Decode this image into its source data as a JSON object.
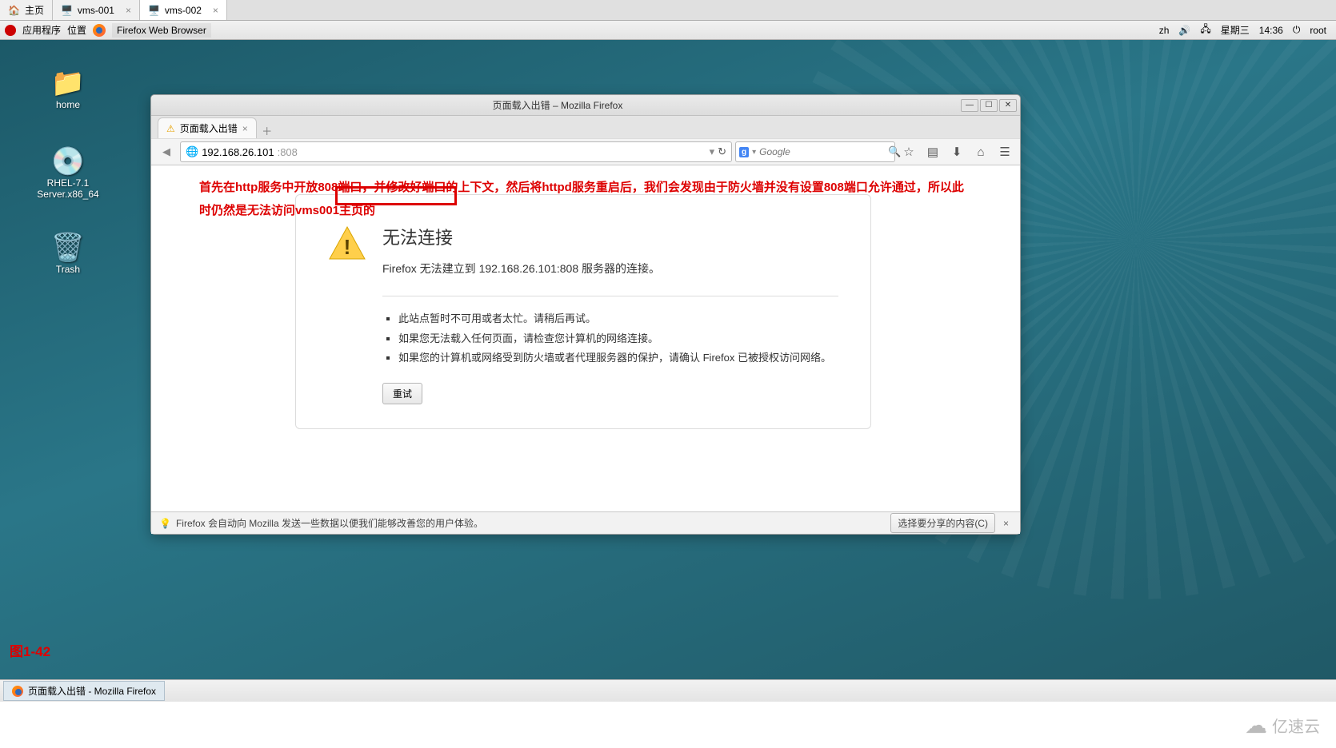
{
  "host_tabs": [
    {
      "label": "主页",
      "icon": "home"
    },
    {
      "label": "vms-001",
      "icon": "vm"
    },
    {
      "label": "vms-002",
      "icon": "vm",
      "active": true
    }
  ],
  "gnome_panel": {
    "apps_label": "应用程序",
    "places_label": "位置",
    "active_app": "Firefox Web Browser",
    "lang": "zh",
    "date": "星期三",
    "time": "14:36",
    "user": "root"
  },
  "desktop_icons": {
    "home": "home",
    "media": "RHEL-7.1 Server.x86_64",
    "trash": "Trash"
  },
  "figure_label": "图1-42",
  "firefox": {
    "window_title": "页面载入出错  –  Mozilla Firefox",
    "tab_title": "页面载入出错",
    "url_host": "192.168.26.101",
    "url_port": "808",
    "search_placeholder": "Google",
    "toolbar_icons": [
      "star",
      "list",
      "download",
      "home",
      "menu"
    ],
    "annotation": "首先在http服务中开放808端口，并修改好端口的上下文，然后将httpd服务重启后，我们会发现由于防火墙并没有设置808端口允许通过，所以此时仍然是无法访问vms001主页的",
    "error": {
      "title": "无法连接",
      "subtitle": "Firefox 无法建立到 192.168.26.101:808 服务器的连接。",
      "bullets": [
        "此站点暂时不可用或者太忙。请稍后再试。",
        "如果您无法载入任何页面，请检查您计算机的网络连接。",
        "如果您的计算机或网络受到防火墙或者代理服务器的保护，请确认 Firefox 已被授权访问网络。"
      ],
      "retry": "重试"
    },
    "statusbar": {
      "left": "Firefox 会自动向 Mozilla 发送一些数据以便我们能够改善您的用户体验。",
      "share_btn": "选择要分享的内容(C)"
    }
  },
  "taskbar": {
    "item": "页面载入出错 - Mozilla Firefox"
  },
  "watermark": "亿速云"
}
